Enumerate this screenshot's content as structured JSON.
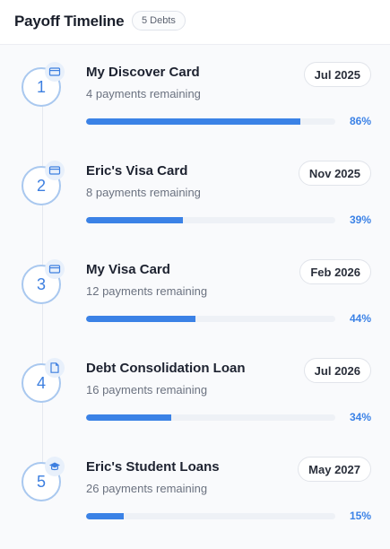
{
  "header": {
    "title": "Payoff Timeline",
    "badge": "5 Debts"
  },
  "colors": {
    "accent": "#3b82e6",
    "circle_border": "#a9c8ef",
    "track": "#eef1f6"
  },
  "debts": [
    {
      "step": "1",
      "name": "My Discover Card",
      "remaining": "4 payments remaining",
      "date": "Jul 2025",
      "progress_label": "86%",
      "progress": 86,
      "icon": "credit-card-icon"
    },
    {
      "step": "2",
      "name": "Eric's Visa Card",
      "remaining": "8 payments remaining",
      "date": "Nov 2025",
      "progress_label": "39%",
      "progress": 39,
      "icon": "credit-card-icon"
    },
    {
      "step": "3",
      "name": "My Visa Card",
      "remaining": "12 payments remaining",
      "date": "Feb 2026",
      "progress_label": "44%",
      "progress": 44,
      "icon": "credit-card-icon"
    },
    {
      "step": "4",
      "name": "Debt Consolidation Loan",
      "remaining": "16 payments remaining",
      "date": "Jul 2026",
      "progress_label": "34%",
      "progress": 34,
      "icon": "document-icon"
    },
    {
      "step": "5",
      "name": "Eric's Student Loans",
      "remaining": "26 payments remaining",
      "date": "May 2027",
      "progress_label": "15%",
      "progress": 15,
      "icon": "graduation-cap-icon"
    }
  ]
}
